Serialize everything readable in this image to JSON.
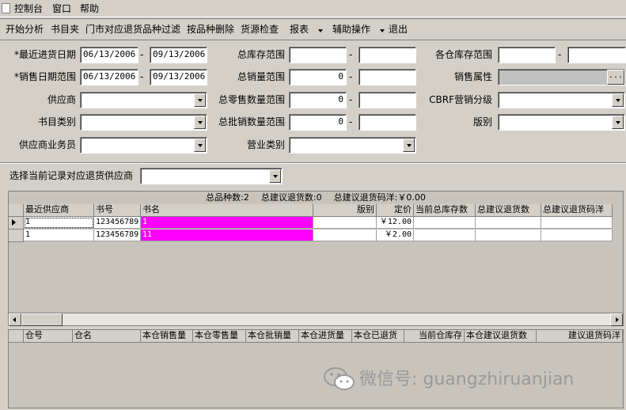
{
  "menu": [
    "控制台",
    "窗口",
    "帮助"
  ],
  "toolbar": [
    {
      "label": "开始分析"
    },
    {
      "label": "书目夹"
    },
    {
      "label": "门市对应退货品种过滤"
    },
    {
      "label": "按品种删除"
    },
    {
      "label": "货源检查"
    },
    {
      "label": "报表",
      "dropdown": true
    },
    {
      "label": "辅助操作",
      "dropdown": true
    },
    {
      "label": "退出"
    }
  ],
  "filters": {
    "recent_stock_date": {
      "label": "*最近进货日期",
      "from": "06/13/2006",
      "to": "09/13/2006"
    },
    "sales_date_range": {
      "label": "*销售日期范围",
      "from": "06/13/2006",
      "to": "09/13/2006"
    },
    "supplier": {
      "label": "供应商",
      "value": ""
    },
    "book_category": {
      "label": "书目类别",
      "value": ""
    },
    "supplier_salesman": {
      "label": "供应商业务员",
      "value": ""
    },
    "total_stock_range": {
      "label": "总库存范围",
      "from": "",
      "to": ""
    },
    "total_sales_range": {
      "label": "总销量范围",
      "from": "0",
      "to": ""
    },
    "total_retail_range": {
      "label": "总零售数量范围",
      "from": "0",
      "to": ""
    },
    "total_wholesale_range": {
      "label": "总批销数量范围",
      "from": "0",
      "to": ""
    },
    "business_type": {
      "label": "营业类别",
      "value": ""
    },
    "warehouse_stock_range": {
      "label": "各仓库存范围",
      "from": "",
      "to": ""
    },
    "sales_attribute": {
      "label": "销售属性",
      "value": "",
      "button": "..."
    },
    "cbrf_category": {
      "label": "CBRF营销分级",
      "value": ""
    },
    "edition": {
      "label": "版别",
      "value": ""
    }
  },
  "select_supplier": {
    "label": "选择当前记录对应退货供应商",
    "value": ""
  },
  "grid1": {
    "summary": {
      "total_titles_label": "总品种数:",
      "total_titles": "2",
      "total_return_qty_label": "总建议退货数:",
      "total_return_qty": "0",
      "total_return_amount_label": "总建议退货码洋:",
      "total_return_amount": "￥0.00"
    },
    "columns": [
      "最近供应商",
      "书号",
      "书名",
      "版别",
      "定价",
      "当前总库存数",
      "总建议退货数",
      "总建议退货码洋"
    ],
    "rows": [
      {
        "supplier": "1",
        "isbn": "123456789",
        "title": "1",
        "edition": "",
        "price": "￥12.00",
        "stock": "",
        "return_qty": "",
        "return_amount": ""
      },
      {
        "supplier": "1",
        "isbn": "123456789",
        "title": "11",
        "edition": "",
        "price": "￥2.00",
        "stock": "",
        "return_qty": "",
        "return_amount": ""
      }
    ]
  },
  "grid2": {
    "columns": [
      "仓号",
      "仓名",
      "本仓销售量",
      "本仓零售量",
      "本仓批销量",
      "本仓进货量",
      "本仓已退货",
      "当前仓库存",
      "本仓建议退货数",
      "建议退货码洋"
    ]
  },
  "watermark": {
    "text": "微信号: guangzhiruanjian",
    "icon": "wechat-icon"
  },
  "colors": {
    "window_bg": "#d4d0c8",
    "highlight": "#ff00ff"
  }
}
